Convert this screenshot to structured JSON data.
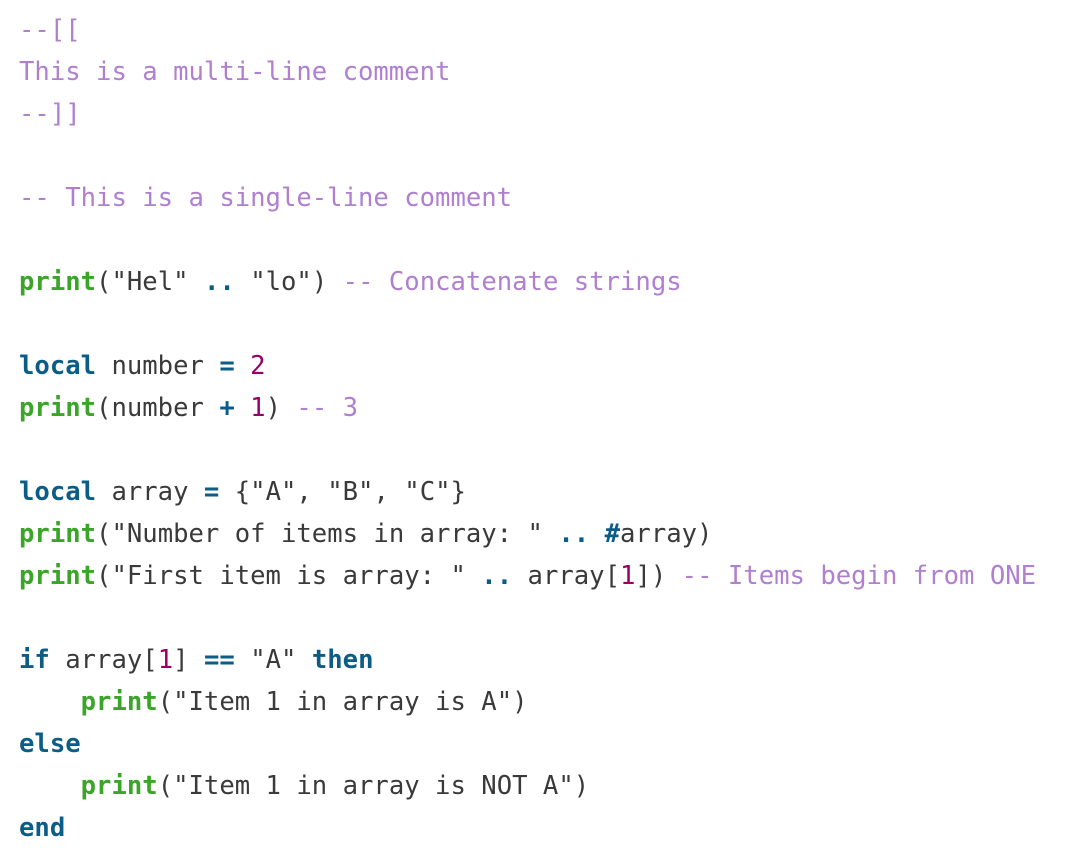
{
  "colors": {
    "background": "#ffffff",
    "comment": "#b07fd0",
    "keyword": "#0b5d87",
    "function": "#3ba52a",
    "number": "#990066",
    "text": "#3a3a3a"
  },
  "code": {
    "language": "Lua",
    "lines": [
      [
        {
          "t": "comment",
          "v": "--[["
        }
      ],
      [
        {
          "t": "comment",
          "v": "This is a multi-line comment"
        }
      ],
      [
        {
          "t": "comment",
          "v": "--]]"
        }
      ],
      [],
      [
        {
          "t": "comment",
          "v": "-- This is a single-line comment"
        }
      ],
      [],
      [
        {
          "t": "func",
          "v": "print"
        },
        {
          "t": "plain",
          "v": "("
        },
        {
          "t": "string",
          "v": "\"Hel\""
        },
        {
          "t": "plain",
          "v": " "
        },
        {
          "t": "op",
          "v": ".."
        },
        {
          "t": "plain",
          "v": " "
        },
        {
          "t": "string",
          "v": "\"lo\""
        },
        {
          "t": "plain",
          "v": ") "
        },
        {
          "t": "comment",
          "v": "-- Concatenate strings"
        }
      ],
      [],
      [
        {
          "t": "keyword",
          "v": "local"
        },
        {
          "t": "plain",
          "v": " number "
        },
        {
          "t": "op",
          "v": "="
        },
        {
          "t": "plain",
          "v": " "
        },
        {
          "t": "number",
          "v": "2"
        }
      ],
      [
        {
          "t": "func",
          "v": "print"
        },
        {
          "t": "plain",
          "v": "(number "
        },
        {
          "t": "op",
          "v": "+"
        },
        {
          "t": "plain",
          "v": " "
        },
        {
          "t": "number",
          "v": "1"
        },
        {
          "t": "plain",
          "v": ") "
        },
        {
          "t": "comment",
          "v": "-- 3"
        }
      ],
      [],
      [
        {
          "t": "keyword",
          "v": "local"
        },
        {
          "t": "plain",
          "v": " array "
        },
        {
          "t": "op",
          "v": "="
        },
        {
          "t": "plain",
          "v": " {"
        },
        {
          "t": "string",
          "v": "\"A\""
        },
        {
          "t": "plain",
          "v": ", "
        },
        {
          "t": "string",
          "v": "\"B\""
        },
        {
          "t": "plain",
          "v": ", "
        },
        {
          "t": "string",
          "v": "\"C\""
        },
        {
          "t": "plain",
          "v": "}"
        }
      ],
      [
        {
          "t": "func",
          "v": "print"
        },
        {
          "t": "plain",
          "v": "("
        },
        {
          "t": "string",
          "v": "\"Number of items in array: \""
        },
        {
          "t": "plain",
          "v": " "
        },
        {
          "t": "op",
          "v": ".."
        },
        {
          "t": "plain",
          "v": " "
        },
        {
          "t": "op",
          "v": "#"
        },
        {
          "t": "plain",
          "v": "array)"
        }
      ],
      [
        {
          "t": "func",
          "v": "print"
        },
        {
          "t": "plain",
          "v": "("
        },
        {
          "t": "string",
          "v": "\"First item is array: \""
        },
        {
          "t": "plain",
          "v": " "
        },
        {
          "t": "op",
          "v": ".."
        },
        {
          "t": "plain",
          "v": " array["
        },
        {
          "t": "number",
          "v": "1"
        },
        {
          "t": "plain",
          "v": "]) "
        },
        {
          "t": "comment",
          "v": "-- Items begin from ONE"
        }
      ],
      [],
      [
        {
          "t": "keyword",
          "v": "if"
        },
        {
          "t": "plain",
          "v": " array["
        },
        {
          "t": "number",
          "v": "1"
        },
        {
          "t": "plain",
          "v": "] "
        },
        {
          "t": "op",
          "v": "=="
        },
        {
          "t": "plain",
          "v": " "
        },
        {
          "t": "string",
          "v": "\"A\""
        },
        {
          "t": "plain",
          "v": " "
        },
        {
          "t": "keyword",
          "v": "then"
        }
      ],
      [
        {
          "t": "indent",
          "v": "    "
        },
        {
          "t": "func",
          "v": "print"
        },
        {
          "t": "plain",
          "v": "("
        },
        {
          "t": "string",
          "v": "\"Item 1 in array is A\""
        },
        {
          "t": "plain",
          "v": ")"
        }
      ],
      [
        {
          "t": "keyword",
          "v": "else"
        }
      ],
      [
        {
          "t": "indent",
          "v": "    "
        },
        {
          "t": "func",
          "v": "print"
        },
        {
          "t": "plain",
          "v": "("
        },
        {
          "t": "string",
          "v": "\"Item 1 in array is NOT A\""
        },
        {
          "t": "plain",
          "v": ")"
        }
      ],
      [
        {
          "t": "keyword",
          "v": "end"
        }
      ]
    ]
  }
}
